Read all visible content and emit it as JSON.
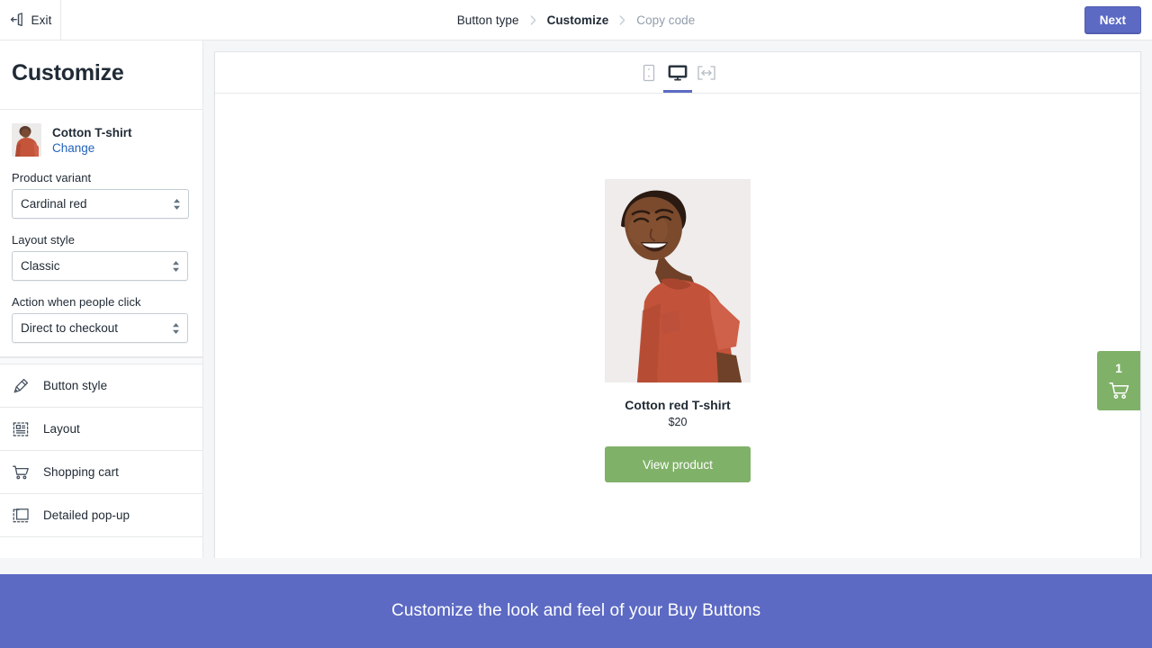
{
  "topbar": {
    "exit_label": "Exit",
    "exit_icon": "exit-door-icon",
    "next_label": "Next",
    "next_color": "#5c6ac4",
    "breadcrumbs": [
      {
        "label": "Button type",
        "state": "done"
      },
      {
        "label": "Customize",
        "state": "active"
      },
      {
        "label": "Copy code",
        "state": "muted"
      }
    ]
  },
  "sidebar": {
    "title": "Customize",
    "product": {
      "name": "Cotton T-shirt",
      "change_label": "Change",
      "change_color": "#2463bc",
      "thumb_icon": "product-thumbnail"
    },
    "fields": [
      {
        "label": "Product variant",
        "value": "Cardinal red",
        "options": [
          "Cardinal red"
        ]
      },
      {
        "label": "Layout style",
        "value": "Classic",
        "options": [
          "Classic"
        ]
      },
      {
        "label": "Action when people click",
        "value": "Direct to checkout",
        "options": [
          "Direct to checkout"
        ]
      }
    ],
    "nav_items": [
      {
        "label": "Button style",
        "icon": "paint-brush-icon"
      },
      {
        "label": "Layout",
        "icon": "layout-grid-icon"
      },
      {
        "label": "Shopping cart",
        "icon": "shopping-cart-icon"
      },
      {
        "label": "Detailed pop-up",
        "icon": "popup-window-icon"
      }
    ]
  },
  "preview": {
    "devices": [
      {
        "name": "mobile",
        "icon": "mobile-device-icon",
        "selected": false
      },
      {
        "name": "desktop",
        "icon": "desktop-monitor-icon",
        "selected": true
      },
      {
        "name": "responsive",
        "icon": "responsive-width-icon",
        "selected": false
      }
    ],
    "active_indicator_color": "#5c6ac4",
    "buy_button": {
      "product_title": "Cotton red T-shirt",
      "price": "$20",
      "button_label": "View product",
      "button_color": "#80b169",
      "photo_alt": "woman-in-red-tshirt-photo"
    },
    "cart": {
      "count": "1",
      "icon": "shopping-cart-icon",
      "color": "#80b169"
    }
  },
  "banner": {
    "text": "Customize the look and feel of your Buy Buttons",
    "background": "#5c6ac4"
  }
}
